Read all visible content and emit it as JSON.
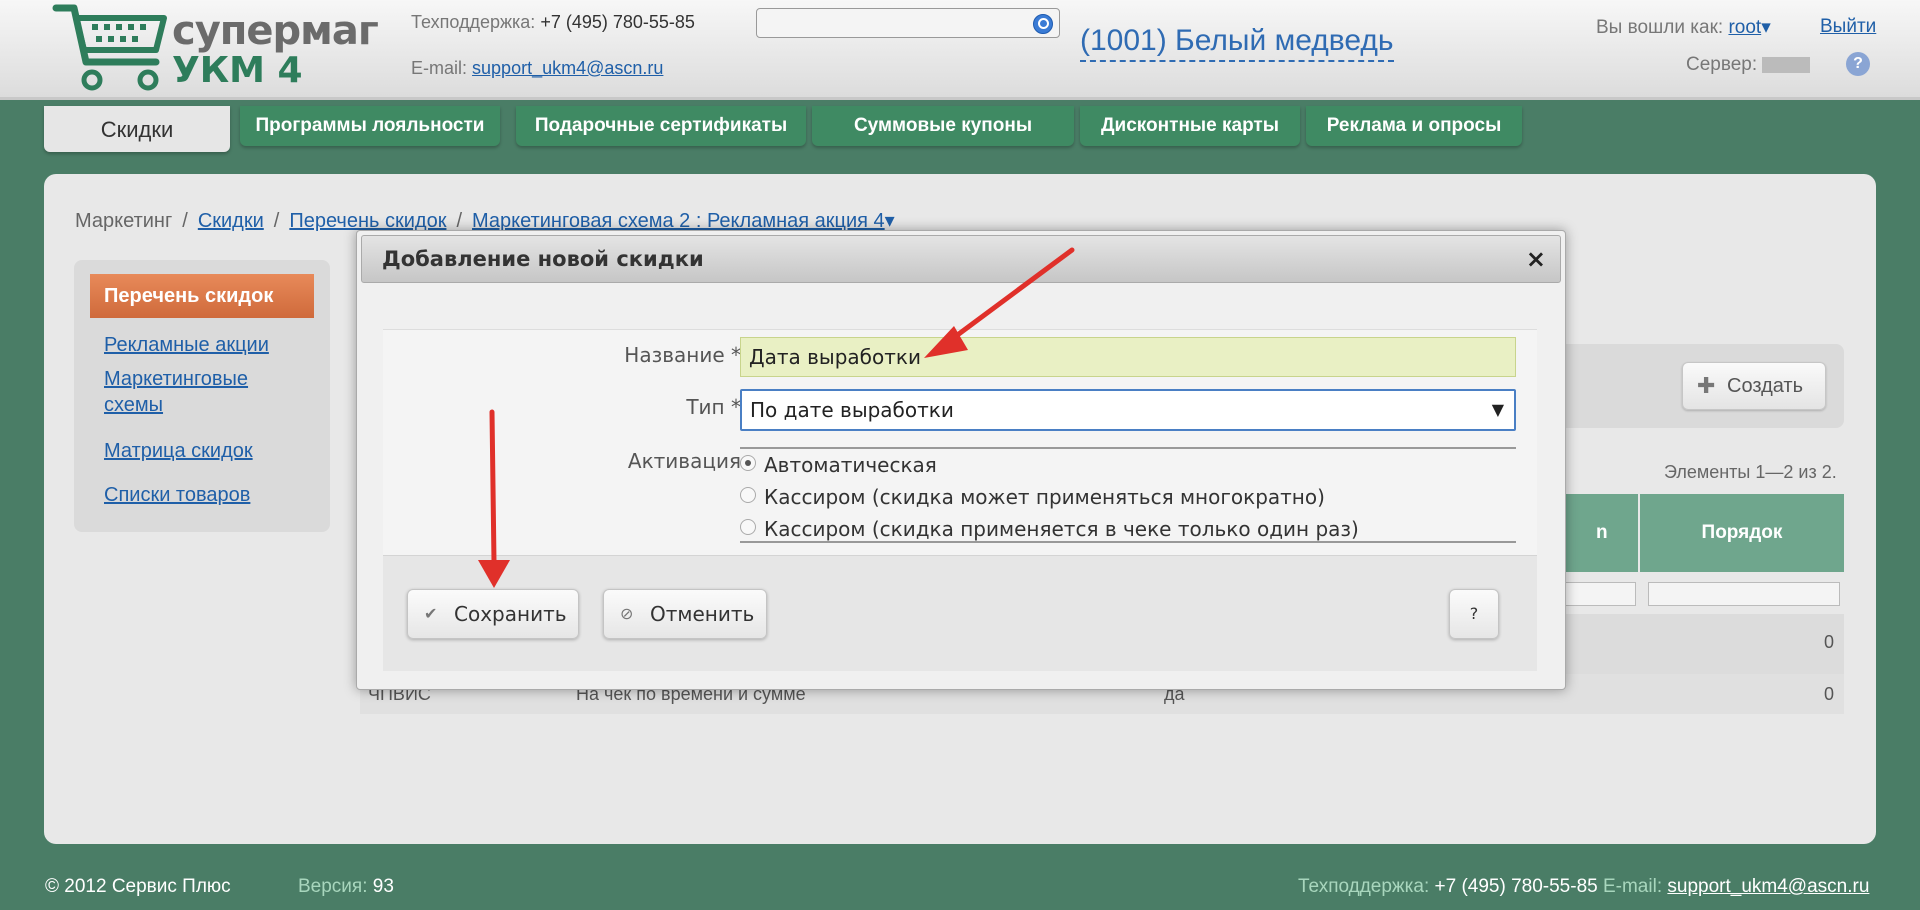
{
  "header": {
    "logo_line1": "супермаг",
    "logo_line2": "УКМ 4",
    "support_label": "Техподдержка:",
    "support_phone": "+7 (495) 780-55-85",
    "email_label": "E-mail:",
    "email": "support_ukm4@ascn.ru",
    "search_value": "",
    "store_name": "(1001) Белый медведь",
    "logged_in_label": "Вы вошли как:",
    "user": "root",
    "user_caret": "▾",
    "logout": "Выйти",
    "server_label": "Сервер:",
    "help": "?"
  },
  "tabs": [
    {
      "label": "Скидки",
      "active": true
    },
    {
      "label": "Программы лояльности"
    },
    {
      "label": "Подарочные сертификаты"
    },
    {
      "label": "Суммовые купоны"
    },
    {
      "label": "Дисконтные карты"
    },
    {
      "label": "Реклама и опросы"
    }
  ],
  "breadcrumb": {
    "root": "Маркетинг",
    "sep": "/",
    "item1": "Скидки",
    "item2": "Перечень скидок",
    "item3": "Маркетинговая схема 2 : Рекламная акция 4",
    "item3_caret": "▾"
  },
  "sidebar": {
    "active": "Перечень скидок",
    "links": [
      "Рекламные акции",
      "Маркетинговые схемы",
      "Матрица скидок",
      "Списки товаров"
    ]
  },
  "toolbar": {
    "create_label": "Создать",
    "create_icon": "plus-icon",
    "count": "Элементы 1—2 из 2."
  },
  "grid": {
    "header_partial": "n",
    "order_header": "Порядок",
    "rows": [
      {
        "code": "",
        "name": "",
        "flag": "",
        "order": "0"
      },
      {
        "code": "ЧПВИС",
        "name": "На чек по времени и сумме",
        "flag": "да",
        "order": "0"
      }
    ]
  },
  "modal": {
    "title": "Добавление новой скидки",
    "close": "×",
    "name_label": "Название *",
    "name_value": "Дата выработки",
    "type_label": "Тип *",
    "type_value": "По дате выработки",
    "type_caret": "▼",
    "activation_label": "Активация",
    "activation_options": [
      {
        "label": "Автоматическая",
        "checked": true
      },
      {
        "label": "Кассиром (скидка может применяться многократно)",
        "checked": false
      },
      {
        "label": "Кассиром (скидка применяется в чеке только один раз)",
        "checked": false
      }
    ],
    "save_label": "Сохранить",
    "save_icon": "check-icon",
    "cancel_label": "Отменить",
    "cancel_icon": "cancel-icon",
    "help_label": "?"
  },
  "footer": {
    "copyright": "© 2012 Сервис Плюс",
    "version_label": "Версия:",
    "version": "93",
    "support_label": "Техподдержка:",
    "support_phone": "+7 (495) 780-55-85",
    "email_label": "E-mail:",
    "email": "support_ukm4@ascn.ru"
  },
  "colors": {
    "background": "#4a7d66",
    "tab_green": "#3f8a63",
    "link_blue": "#1f5fa8",
    "sidebar_active": "#cf6a3b",
    "annotation_red": "#e0302a"
  }
}
